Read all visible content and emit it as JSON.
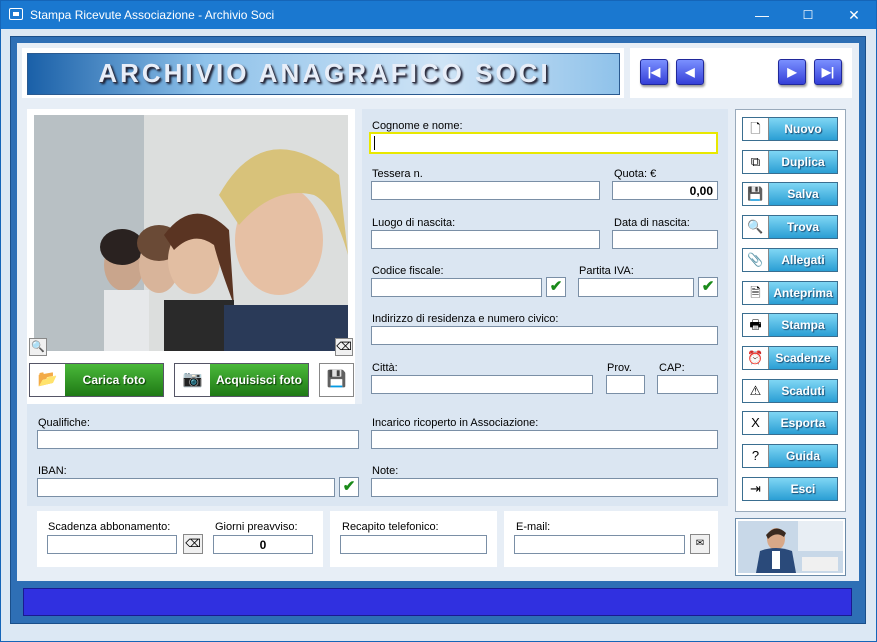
{
  "window": {
    "title": "Stampa Ricevute Associazione - Archivio Soci",
    "minimize": "—",
    "maximize": "☐",
    "close": "✕"
  },
  "header": {
    "title": "ARCHIVIO ANAGRAFICO SOCI"
  },
  "nav": {
    "first": "|◀",
    "prev": "◀",
    "next": "▶",
    "last": "▶|"
  },
  "photo": {
    "zoom_icon": "🔍",
    "erase_icon": "⌫",
    "load_label": "Carica foto",
    "acquire_label": "Acquisisci foto",
    "save_icon": "💾"
  },
  "form": {
    "cognome_label": "Cognome e nome:",
    "cognome_value": "",
    "tessera_label": "Tessera n.",
    "tessera_value": "",
    "quota_label": "Quota: €",
    "quota_value": "0,00",
    "luogo_label": "Luogo di nascita:",
    "luogo_value": "",
    "data_label": "Data di nascita:",
    "data_value": "",
    "cf_label": "Codice fiscale:",
    "cf_value": "",
    "piva_label": "Partita IVA:",
    "piva_value": "",
    "indirizzo_label": "Indirizzo di residenza e numero civico:",
    "indirizzo_value": "",
    "citta_label": "Città:",
    "citta_value": "",
    "prov_label": "Prov.",
    "prov_value": "",
    "cap_label": "CAP:",
    "cap_value": "",
    "qualifiche_label": "Qualifiche:",
    "qualifiche_value": "",
    "incarico_label": "Incarico ricoperto in Associazione:",
    "incarico_value": "",
    "iban_label": "IBAN:",
    "iban_value": "",
    "note_label": "Note:",
    "note_value": "",
    "scadenza_label": "Scadenza abbonamento:",
    "scadenza_value": "",
    "giorni_label": "Giorni preavviso:",
    "giorni_value": "0",
    "recapito_label": "Recapito telefonico:",
    "recapito_value": "",
    "email_label": "E-mail:",
    "email_value": "",
    "check_mark": "✔"
  },
  "sidebar": {
    "items": [
      {
        "label": "Nuovo",
        "icon": "🗋"
      },
      {
        "label": "Duplica",
        "icon": "⧉"
      },
      {
        "label": "Salva",
        "icon": "💾"
      },
      {
        "label": "Trova",
        "icon": "🔍"
      },
      {
        "label": "Allegati",
        "icon": "📎"
      },
      {
        "label": "Anteprima",
        "icon": "🗎"
      },
      {
        "label": "Stampa",
        "icon": "🖶"
      },
      {
        "label": "Scadenze",
        "icon": "⏰"
      },
      {
        "label": "Scaduti",
        "icon": "⚠"
      },
      {
        "label": "Esporta",
        "icon": "X"
      },
      {
        "label": "Guida",
        "icon": "?"
      },
      {
        "label": "Esci",
        "icon": "⇥"
      }
    ]
  },
  "colors": {
    "accent": "#2e6fb5",
    "status_bar": "#3030e0",
    "focus": "#e8e800"
  }
}
